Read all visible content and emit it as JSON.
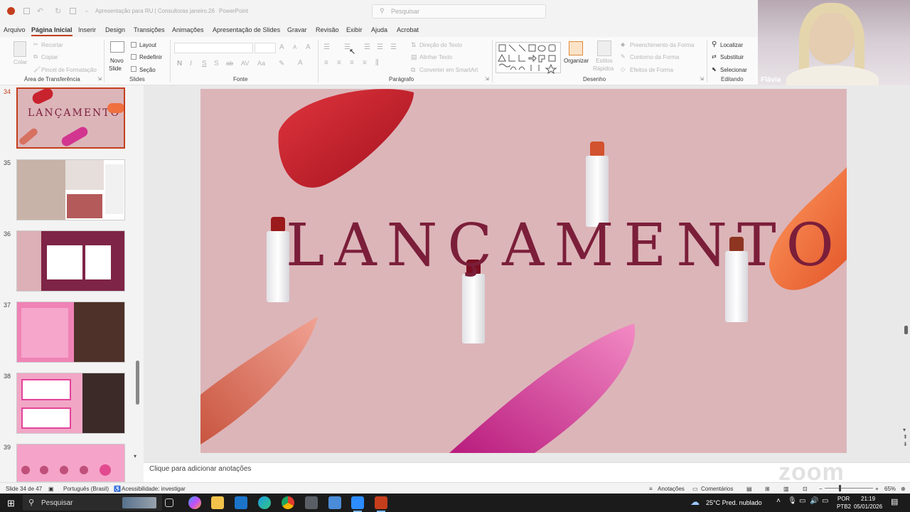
{
  "titlebar": {
    "autosave_hint": "",
    "document_title": "Apresentação para RU | Consultoras janeiro.26",
    "app_name": "PowerPoint",
    "search_placeholder": "Pesquisar"
  },
  "menu": [
    "Arquivo",
    "Página Inicial",
    "Inserir",
    "Design",
    "Transições",
    "Animações",
    "Apresentação de Slides",
    "Gravar",
    "Revisão",
    "Exibir",
    "Ajuda",
    "Acrobat"
  ],
  "ribbon": {
    "clipboard": {
      "paste": "Colar",
      "cut": "Recortar",
      "copy": "Copiar",
      "format_painter": "Pincel de Formatação",
      "group": "Área de Transferência"
    },
    "slides": {
      "new_slide_1": "Novo",
      "new_slide_2": "Slide",
      "layout": "Layout",
      "reset": "Redefinir",
      "section": "Seção",
      "group": "Slides"
    },
    "font": {
      "group": "Fonte"
    },
    "paragraph": {
      "text_direction": "Direção do Texto",
      "align_text": "Alinhar Texto",
      "convert_smartart": "Converter em SmartArt",
      "group": "Parágrafo"
    },
    "drawing": {
      "arrange": "Organizar",
      "quick_styles_1": "Estilos",
      "quick_styles_2": "Rápidos",
      "shape_fill": "Preenchimento da Forma",
      "shape_outline": "Contorno da Forma",
      "shape_effects": "Efeitos de Forma",
      "group": "Desenho"
    },
    "editing": {
      "find": "Localizar",
      "replace": "Substituir",
      "select": "Selecionar",
      "group": "Editando"
    }
  },
  "webcam": {
    "participant": "Flávia"
  },
  "slides_panel": [
    {
      "num": "34",
      "selected": true
    },
    {
      "num": "35",
      "selected": false
    },
    {
      "num": "36",
      "selected": false
    },
    {
      "num": "37",
      "selected": false
    },
    {
      "num": "38",
      "selected": false
    },
    {
      "num": "39",
      "selected": false
    }
  ],
  "slide": {
    "title": "LANÇAMENTO"
  },
  "notes_placeholder": "Clique para adicionar anotações",
  "zoom_watermark": "zoom",
  "statusbar": {
    "slide_info": "Slide 34 de 47",
    "language": "Português (Brasil)",
    "accessibility": "Acessibilidade: investigar",
    "notes": "Anotações",
    "comments": "Comentários",
    "zoom": "65%"
  },
  "taskbar": {
    "search": "Pesquisar",
    "weather": "25°C  Pred. nublado",
    "lang1": "POR",
    "lang2": "PTB2",
    "time": "21:19",
    "date": "05/01/2026"
  },
  "colors": {
    "accent": "#c43e1c",
    "slide_bg": "#dcb5b9",
    "title_color": "#7b1e3a"
  }
}
